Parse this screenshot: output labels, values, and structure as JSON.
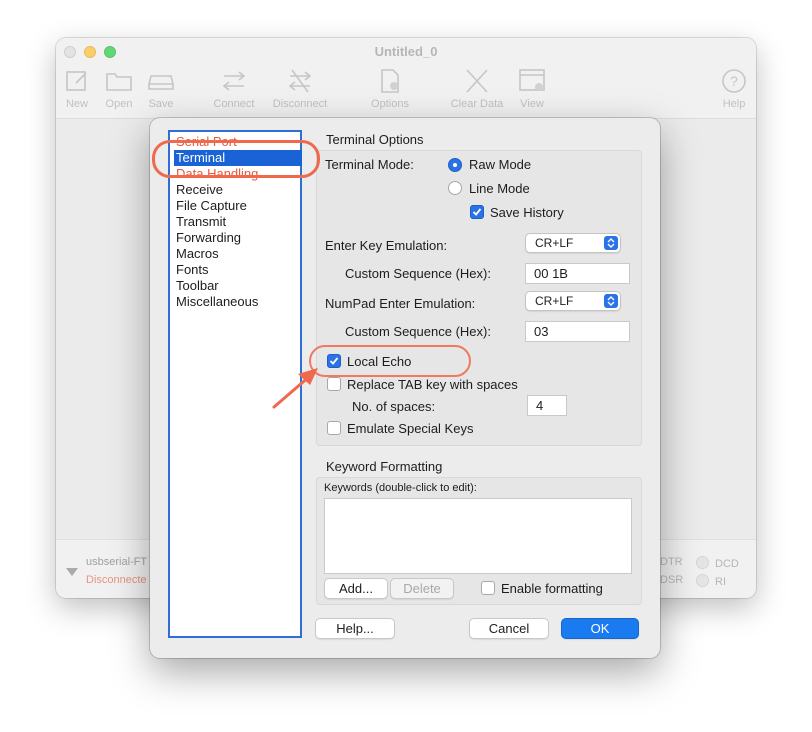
{
  "window": {
    "title": "Untitled_0",
    "toolbar": [
      {
        "label": "New",
        "icon": "new-document-icon"
      },
      {
        "label": "Open",
        "icon": "folder-icon"
      },
      {
        "label": "Save",
        "icon": "save-drive-icon"
      },
      {
        "label": "Connect",
        "icon": "connect-arrows-icon"
      },
      {
        "label": "Disconnect",
        "icon": "disconnect-arrows-icon"
      },
      {
        "label": "Options",
        "icon": "options-gear-icon"
      },
      {
        "label": "Clear Data",
        "icon": "clear-x-icon"
      },
      {
        "label": "View",
        "icon": "view-window-icon"
      },
      {
        "label": "Help",
        "icon": "help-icon"
      }
    ],
    "status": {
      "port": "usbserial-FT",
      "state": "Disconnecte",
      "leds": [
        "DTR",
        "DCD",
        "DSR",
        "RI"
      ]
    }
  },
  "dialog": {
    "categories": [
      "Serial Port",
      "Terminal",
      "Data Handling",
      "Receive",
      "File Capture",
      "Transmit",
      "Forwarding",
      "Macros",
      "Fonts",
      "Toolbar",
      "Miscellaneous"
    ],
    "selected_category": "Terminal",
    "terminal_options": {
      "title": "Terminal Options",
      "mode_label": "Terminal Mode:",
      "raw_mode": "Raw Mode",
      "line_mode": "Line Mode",
      "save_history": "Save History",
      "enter_key_label": "Enter Key Emulation:",
      "enter_key_value": "CR+LF",
      "custom_seq_label": "Custom Sequence (Hex):",
      "custom_seq_value": "00 1B",
      "numpad_label": "NumPad Enter Emulation:",
      "numpad_value": "CR+LF",
      "custom_seq2_label": "Custom Sequence (Hex):",
      "custom_seq2_value": "03",
      "local_echo": "Local Echo",
      "replace_tab": "Replace TAB key with spaces",
      "num_spaces_label": "No. of spaces:",
      "num_spaces_value": "4",
      "emulate_keys": "Emulate Special Keys"
    },
    "keyword": {
      "title": "Keyword Formatting",
      "list_label": "Keywords (double-click to edit):",
      "add": "Add...",
      "delete": "Delete",
      "enable": "Enable formatting"
    },
    "buttons": {
      "help": "Help...",
      "cancel": "Cancel",
      "ok": "OK"
    }
  },
  "colors": {
    "accent": "#1a7af0",
    "annotation": "#ef6a4d"
  }
}
